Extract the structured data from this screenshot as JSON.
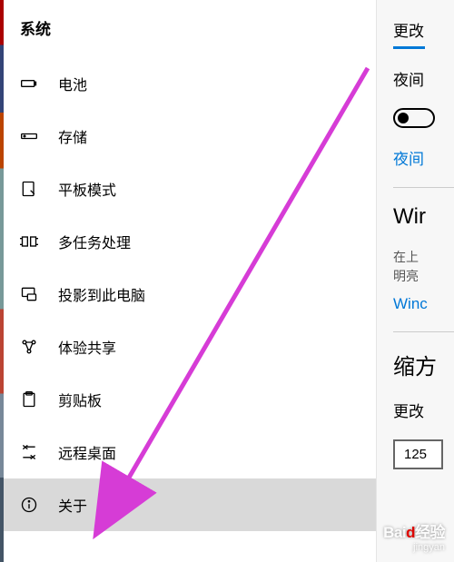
{
  "sidebar": {
    "title": "系统",
    "items": [
      {
        "label": "电池"
      },
      {
        "label": "存储"
      },
      {
        "label": "平板模式"
      },
      {
        "label": "多任务处理"
      },
      {
        "label": "投影到此电脑"
      },
      {
        "label": "体验共享"
      },
      {
        "label": "剪贴板"
      },
      {
        "label": "远程桌面"
      },
      {
        "label": "关于"
      }
    ]
  },
  "right": {
    "change_label": "更改",
    "night_label": "夜间",
    "night_link": "夜间",
    "win_heading": "Wir",
    "desc1": "在上",
    "desc2": "明亮",
    "win_link": "Winc",
    "zoom_heading": "缩方",
    "change2_label": "更改",
    "zoom_value": "125"
  },
  "watermark": {
    "brand_prefix": "Bai",
    "brand_mid": "d",
    "brand_suffix": "经验",
    "sub": "jingyan"
  }
}
